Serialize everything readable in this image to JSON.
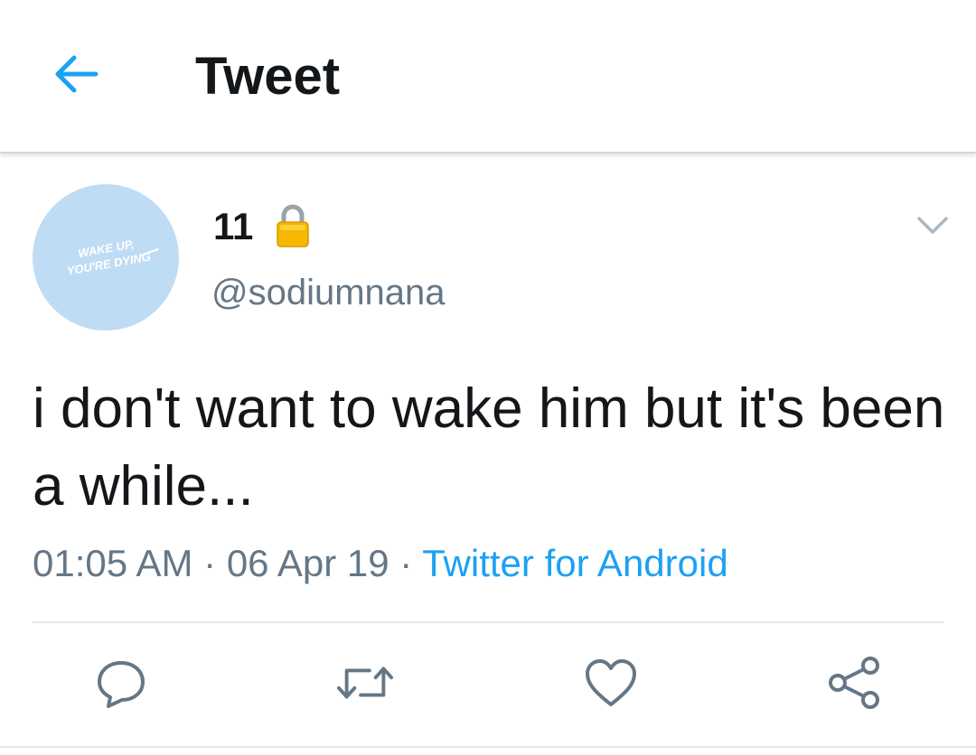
{
  "header": {
    "title": "Tweet",
    "back_icon": "arrow-left-icon",
    "accent_color": "#1da1f2"
  },
  "tweet": {
    "author": {
      "display_name": "11",
      "handle": "@sodiumnana",
      "protected_icon": "lock-icon",
      "avatar_text_line1": "WAKE UP,",
      "avatar_text_line2": "YOU'RE DYING",
      "avatar_color": "#bfdcf5"
    },
    "text": "i don't want to wake him but it's been a while...",
    "time": "01:05 AM",
    "separator": "·",
    "date": "06 Apr 19",
    "source": "Twitter for Android",
    "menu_icon": "chevron-down-icon"
  },
  "actions": {
    "reply_icon": "reply-icon",
    "retweet_icon": "retweet-icon",
    "like_icon": "heart-icon",
    "share_icon": "share-icon"
  }
}
